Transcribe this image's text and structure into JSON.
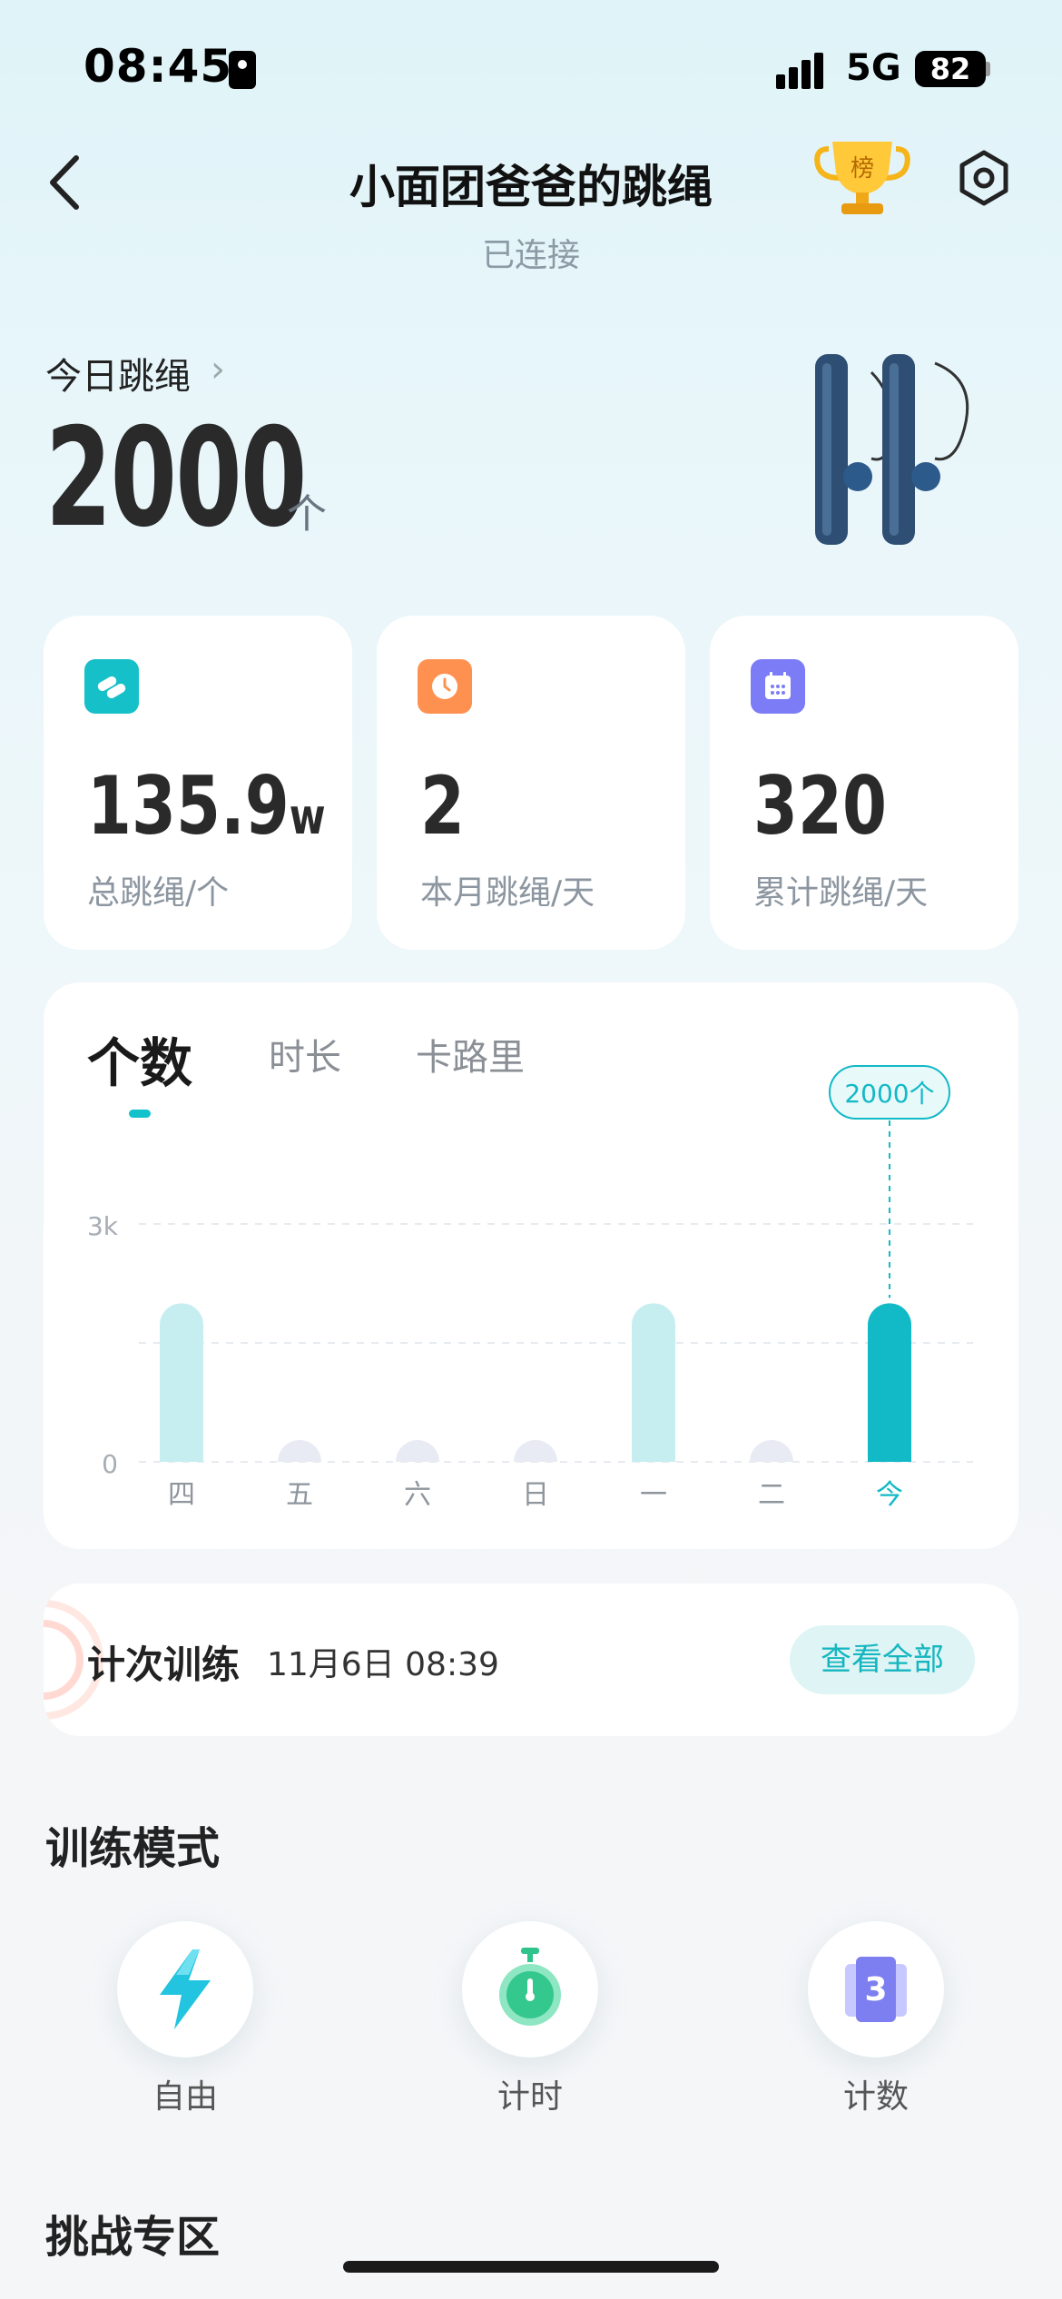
{
  "status_bar": {
    "time": "08:45",
    "network": "5G",
    "battery": "82"
  },
  "header": {
    "title": "小面团爸爸的跳绳",
    "subtitle": "已连接",
    "trophy_text": "榜"
  },
  "today": {
    "label": "今日跳绳",
    "value": "2000",
    "unit": "个"
  },
  "stats": [
    {
      "value": "135.9",
      "suffix": "w",
      "label": "总跳绳/个",
      "icon": "rope-icon",
      "color": "#16c0c8"
    },
    {
      "value": "2",
      "suffix": "",
      "label": "本月跳绳/天",
      "icon": "clock-icon",
      "color": "#ff9150"
    },
    {
      "value": "320",
      "suffix": "",
      "label": "累计跳绳/天",
      "icon": "calendar-icon",
      "color": "#7c7cf6"
    }
  ],
  "chart_tabs": [
    "个数",
    "时长",
    "卡路里"
  ],
  "chart_data": {
    "type": "bar",
    "categories": [
      "四",
      "五",
      "六",
      "日",
      "一",
      "二",
      "今"
    ],
    "values": [
      2000,
      0,
      0,
      0,
      2000,
      0,
      2000
    ],
    "highlight_index": 6,
    "ylim": [
      0,
      3000
    ],
    "ytick_labels": [
      "0",
      "3k"
    ],
    "tooltip": "2000个",
    "colors": {
      "bar": "#c6eef1",
      "active": "#12b9c6",
      "empty": "#e8ebf3"
    }
  },
  "record": {
    "title": "计次训练",
    "time": "11月6日 08:39",
    "button": "查看全部"
  },
  "modes_title": "训练模式",
  "modes": [
    {
      "label": "自由",
      "icon": "lightning-icon"
    },
    {
      "label": "计时",
      "icon": "stopwatch-icon"
    },
    {
      "label": "计数",
      "icon": "counter-icon"
    }
  ],
  "challenge_title": "挑战专区"
}
